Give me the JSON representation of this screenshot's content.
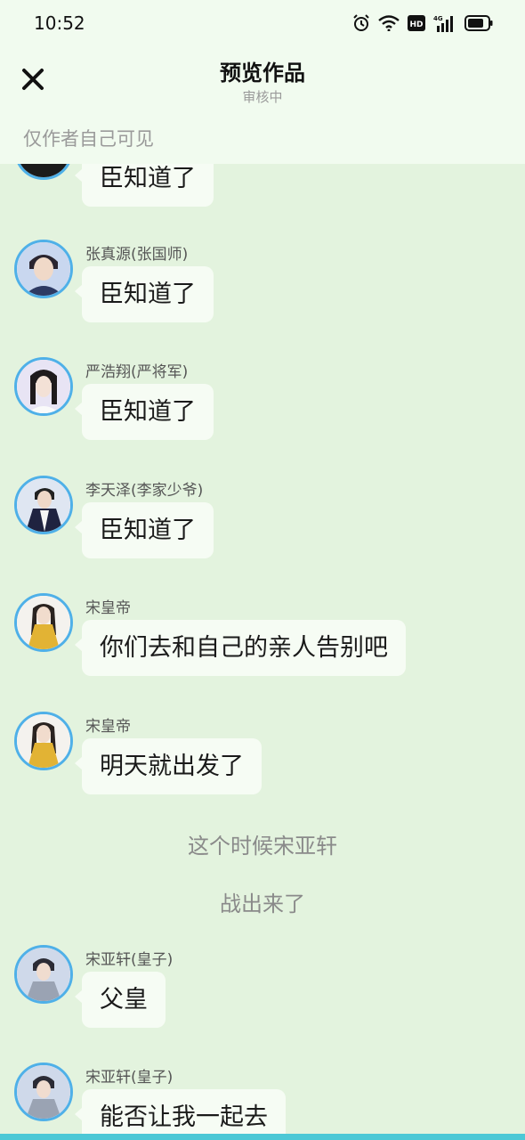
{
  "status_bar": {
    "time": "10:52",
    "network": "4G",
    "hd": "HD"
  },
  "header": {
    "title": "预览作品",
    "subtitle": "审核中",
    "notice": "仅作者自己可见"
  },
  "messages": [
    {
      "name": "",
      "text": "臣知道了"
    },
    {
      "name": "张真源(张国师)",
      "text": "臣知道了"
    },
    {
      "name": "严浩翔(严将军)",
      "text": "臣知道了"
    },
    {
      "name": "李天泽(李家少爷)",
      "text": "臣知道了"
    },
    {
      "name": "宋皇帝",
      "text": "你们去和自己的亲人告别吧"
    },
    {
      "name": "宋皇帝",
      "text": "明天就出发了"
    },
    {
      "name": "宋亚轩(皇子)",
      "text": "父皇"
    },
    {
      "name": "宋亚轩(皇子)",
      "text": "能否让我一起去"
    }
  ],
  "narrations": [
    "这个时候宋亚轩",
    "战出来了"
  ],
  "colors": {
    "background": "#e3f3de",
    "header_bg": "#f1fbef",
    "bubble": "#f6fcf4",
    "avatar_border": "#4fb0e8",
    "bottom_strip": "#4cc8d6"
  },
  "icons": [
    "close-icon",
    "alarm-icon",
    "wifi-icon",
    "signal-icon",
    "battery-icon"
  ]
}
